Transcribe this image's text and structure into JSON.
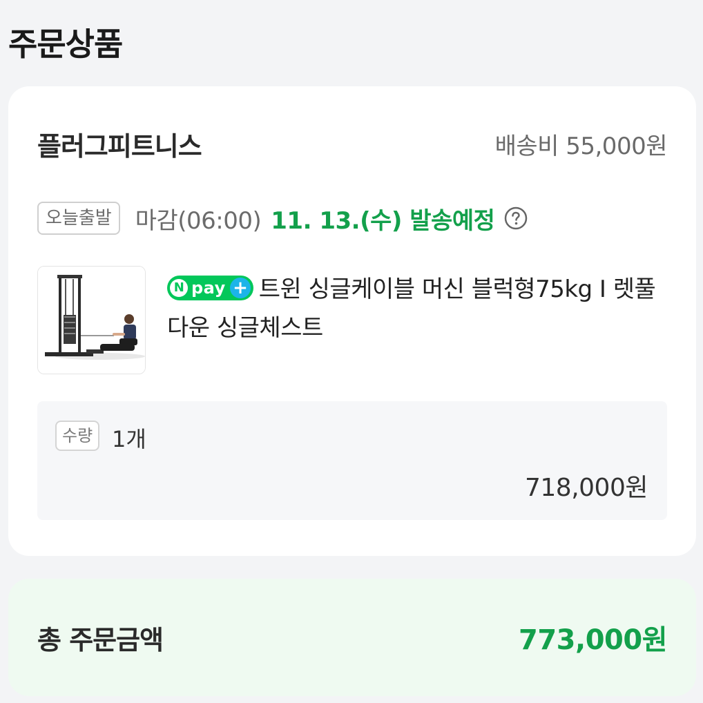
{
  "page": {
    "section_title": "주문상품"
  },
  "order": {
    "seller_name": "플러그피트니스",
    "shipping_fee": "배송비 55,000원",
    "dispatch": {
      "badge": "오늘출발",
      "deadline": "마감(06:00)",
      "ship_date": "11. 13.(수) 발송예정"
    },
    "product": {
      "npay_n": "N",
      "npay_word": "pay",
      "npay_plus": "+",
      "name": "트윈 싱글케이블 머신 블럭형75kg I 렛풀다운 싱글체스트"
    },
    "quantity": {
      "label": "수량",
      "value": "1개"
    },
    "item_price": "718,000원"
  },
  "total": {
    "label": "총 주문금액",
    "value": "773,000원"
  },
  "colors": {
    "accent_green": "#13a04b",
    "npay_green": "#03c75a",
    "npay_plus_blue": "#1cb4e9",
    "total_bg": "#effaf1"
  },
  "icons": {
    "help": "question-circle-icon"
  }
}
